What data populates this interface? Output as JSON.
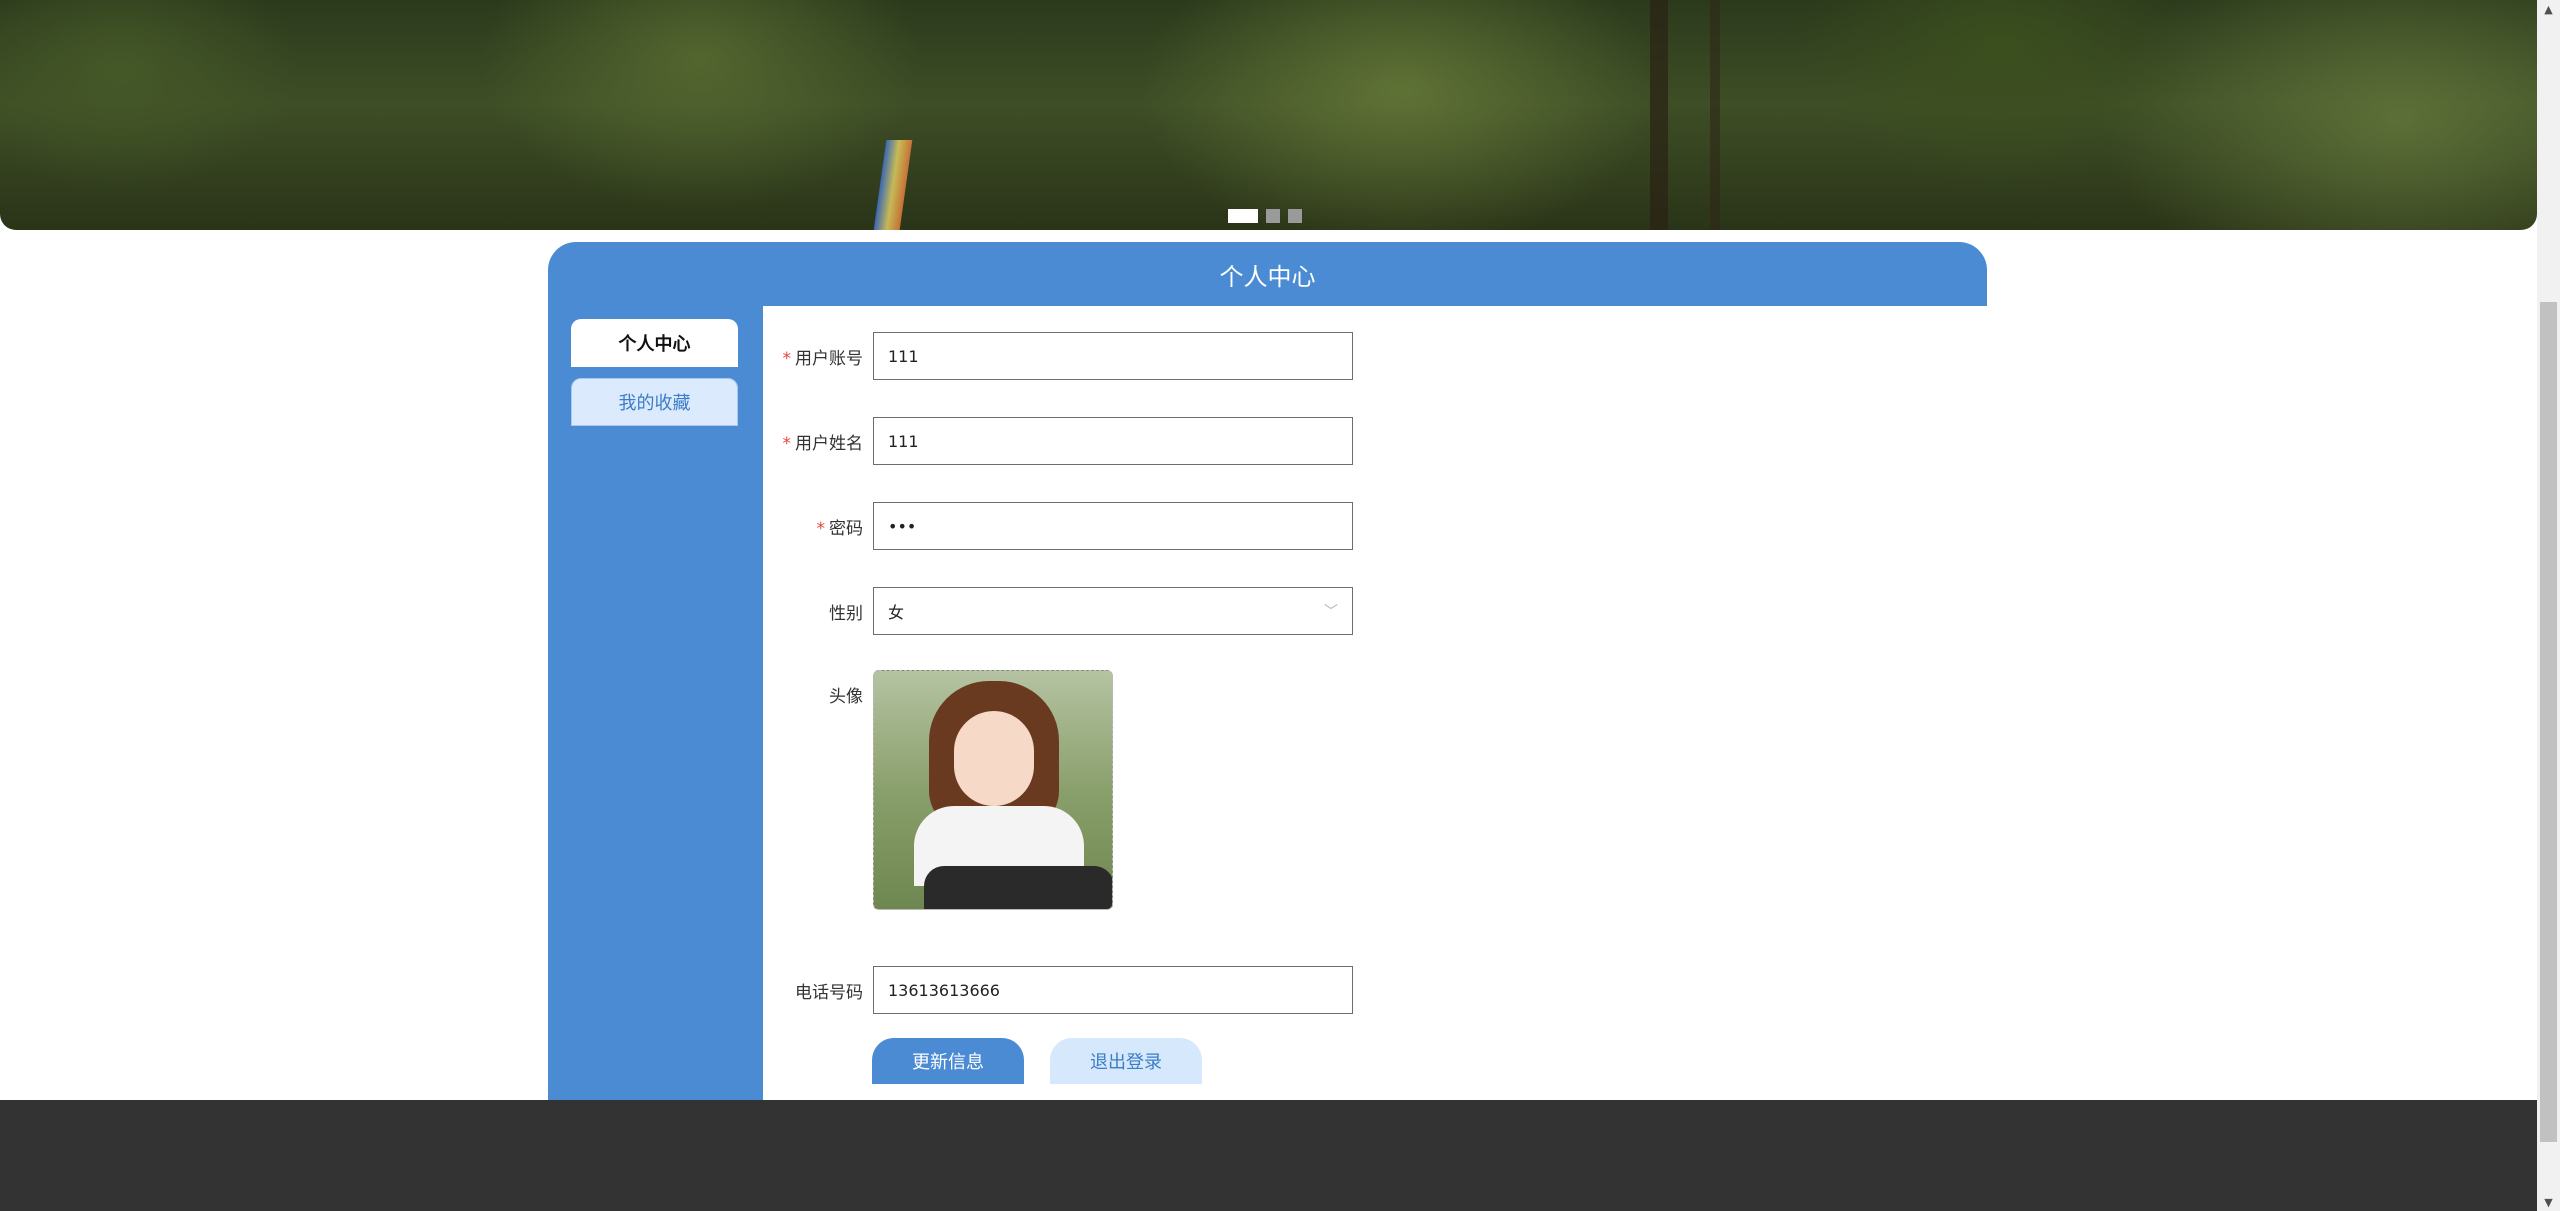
{
  "banner": {
    "slide_count": 3,
    "active_slide": 1
  },
  "panel": {
    "title": "个人中心"
  },
  "sidebar": {
    "items": [
      {
        "label": "个人中心",
        "active": true
      },
      {
        "label": "我的收藏",
        "active": false
      }
    ]
  },
  "form": {
    "account": {
      "label": "用户账号",
      "required": true,
      "value": "111"
    },
    "name": {
      "label": "用户姓名",
      "required": true,
      "value": "111"
    },
    "password": {
      "label": "密码",
      "required": true,
      "value": "•••"
    },
    "gender": {
      "label": "性别",
      "value": "女"
    },
    "avatar": {
      "label": "头像"
    },
    "phone": {
      "label": "电话号码",
      "value": "13613613666"
    },
    "required_mark": "*"
  },
  "actions": {
    "update_label": "更新信息",
    "logout_label": "退出登录"
  },
  "colors": {
    "primary": "#4a8bd3",
    "secondary_bg": "#d6e8fb",
    "required": "#e8443a",
    "footer": "#333333"
  }
}
